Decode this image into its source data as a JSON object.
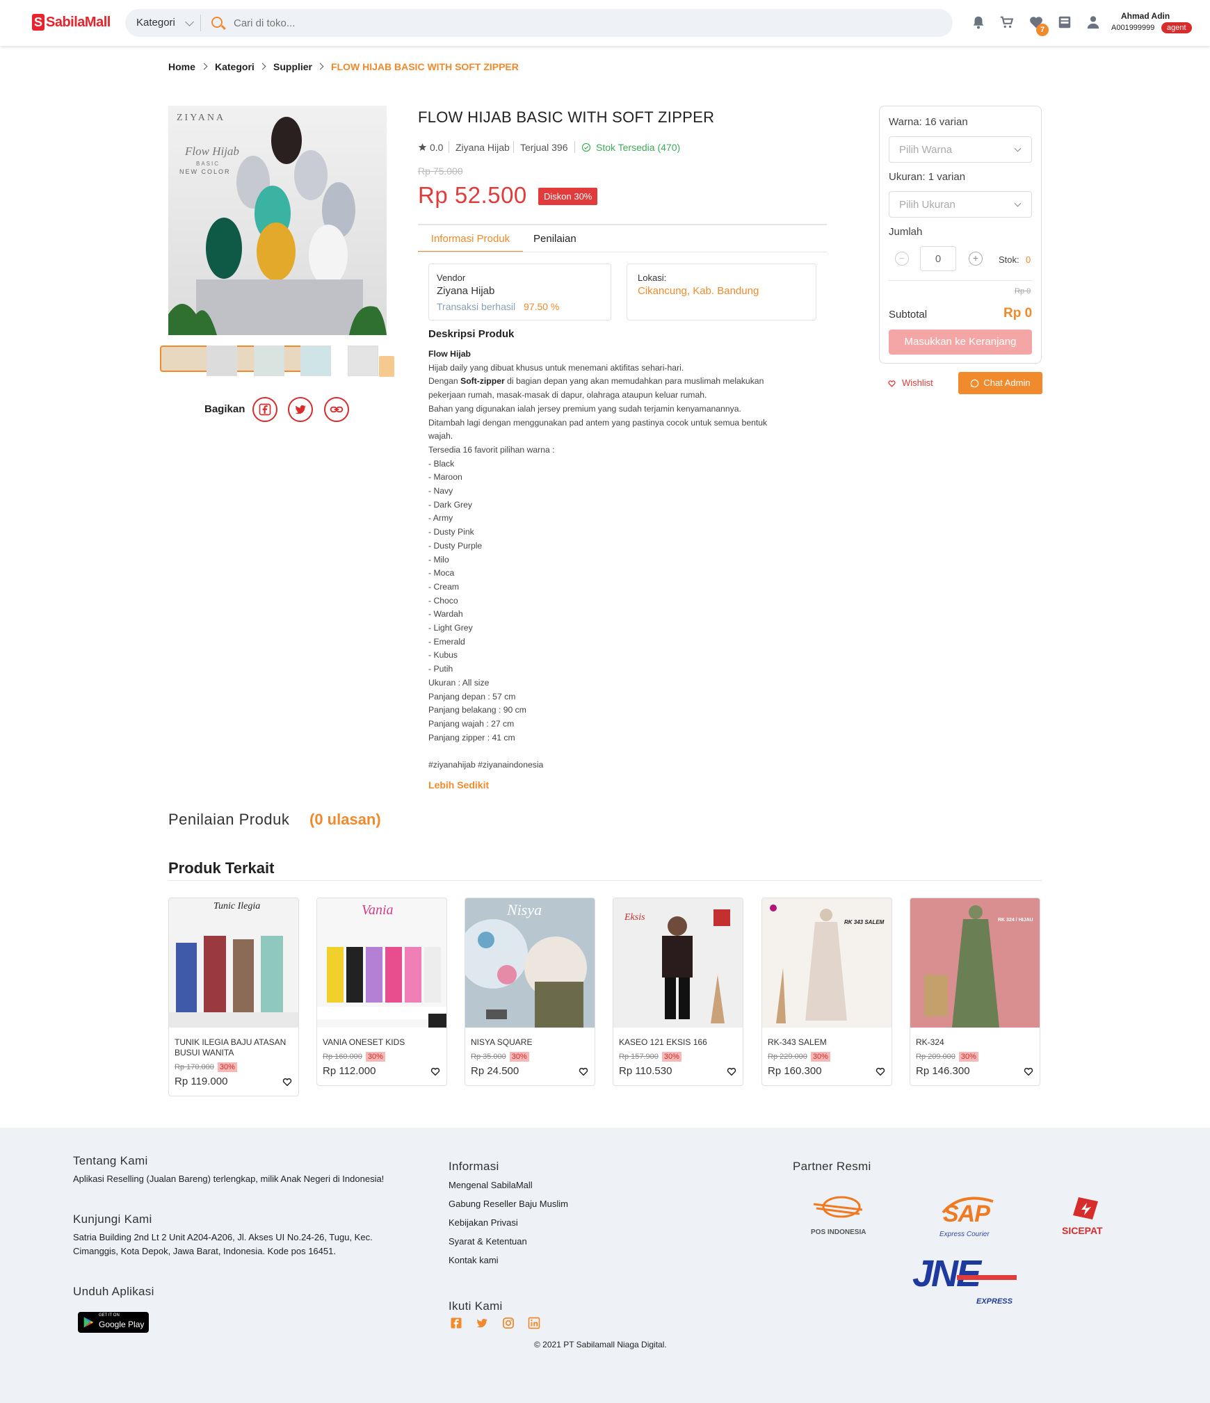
{
  "header": {
    "logo_mark": "S",
    "logo_text": "SabilaMall",
    "category_label": "Kategori",
    "search_placeholder": "Cari di toko...",
    "wishlist_badge": "7",
    "user_name": "Ahmad Adin",
    "user_id": "A001999999",
    "user_role": "agent",
    "icons": [
      "bell-icon",
      "cart-icon",
      "heart-icon",
      "inbox-icon",
      "user-icon"
    ]
  },
  "breadcrumb": [
    "Home",
    "Kategori",
    "Supplier",
    "FLOW HIJAB BASIC WITH SOFT ZIPPER"
  ],
  "gallery": {
    "brand_text": "ZIYANA",
    "script_text": "Flow Hijab",
    "sub_text": "BASIC",
    "sub_text2": "NEW COLOR",
    "share_label": "Bagikan",
    "share_icons": [
      "facebook-icon",
      "twitter-icon",
      "link-icon"
    ]
  },
  "product": {
    "title": "FLOW HIJAB BASIC WITH SOFT ZIPPER",
    "rating": "0.0",
    "seller": "Ziyana Hijab",
    "sold": "Terjual 396",
    "stock": "Stok Tersedia (470)",
    "old_price": "Rp 75.000",
    "price": "Rp 52.500",
    "discount": "Diskon 30%",
    "tabs": [
      "Informasi Produk",
      "Penilaian"
    ],
    "vendor_label": "Vendor",
    "vendor_name": "Ziyana Hijab",
    "transaksi_label": "Transaksi berhasil",
    "transaksi_value": "97.50 %",
    "lokasi_label": "Lokasi:",
    "lokasi_value": "Cikancung, Kab. Bandung",
    "desc_heading": "Deskripsi Produk",
    "desc_title": "Flow Hijab",
    "desc_line1": "Hijab daily yang dibuat khusus untuk menemani aktifitas sehari-hari.",
    "desc_line2_pre": "Dengan ",
    "desc_line2_bold": "Soft-zipper",
    "desc_line2_post": " di bagian depan yang akan memudahkan para muslimah melakukan\npekerjaan rumah, masak-masak di dapur, olahraga ataupun keluar rumah.",
    "desc_rest": "Bahan yang digunakan ialah jersey premium yang sudah terjamin kenyamanannya.\nDitambah lagi dengan menggunakan pad antem yang pastinya cocok untuk semua bentuk\nwajah.\nTersedia 16 favorit pilihan warna :\n- Black\n- Maroon\n- Navy\n- Dark Grey\n- Army\n- Dusty Pink\n- Dusty Purple\n- Milo\n- Moca\n- Cream\n- Choco\n- Wardah\n- Light Grey\n- Emerald\n- Kubus\n- Putih\nUkuran : All size\nPanjang depan : 57 cm\nPanjang belakang : 90 cm\nPanjang wajah : 27 cm\nPanjang zipper : 41 cm\n\n#ziyanahijab #ziyanaindonesia",
    "less_link": "Lebih Sedikit"
  },
  "purchase": {
    "warna_label": "Warna: 16 varian",
    "warna_placeholder": "Pilih Warna",
    "ukuran_label": "Ukuran: 1 varian",
    "ukuran_placeholder": "Pilih Ukuran",
    "jumlah_label": "Jumlah",
    "qty_minus": "−",
    "qty_value": "0",
    "qty_plus": "+",
    "stok_label": "Stok:",
    "stok_value": "0",
    "small_price": "Rp 0",
    "subtotal_label": "Subtotal",
    "subtotal_value": "Rp 0",
    "add_to_cart": "Masukkan ke Keranjang",
    "wishlist": "Wishlist",
    "chat_admin": "Chat Admin"
  },
  "ratings": {
    "heading": "Penilaian Produk",
    "count": "(0 ulasan)"
  },
  "related": {
    "heading": "Produk Terkait",
    "items": [
      {
        "name": "TUNIK ILEGIA BAJU ATASAN BUSUI WANITA",
        "old_price": "Rp 170.000",
        "pct": "30%",
        "price": "Rp 119.000",
        "color": "#9a3a3f",
        "img_title": "Tunic Ilegia"
      },
      {
        "name": "VANIA ONESET KIDS",
        "old_price": "Rp 160.000",
        "pct": "30%",
        "price": "Rp 112.000",
        "color": "#e45a9a",
        "img_title": "Vania"
      },
      {
        "name": "NISYA SQUARE",
        "old_price": "Rp 35.000",
        "pct": "30%",
        "price": "Rp 24.500",
        "color": "#8ab3c8",
        "img_title": "Nisya"
      },
      {
        "name": "KASEO 121 EKSIS 166",
        "old_price": "Rp 157.900",
        "pct": "30%",
        "price": "Rp 110.530",
        "color": "#3a2a2a",
        "img_title": "Eksis"
      },
      {
        "name": "RK-343 SALEM",
        "old_price": "Rp 229.000",
        "pct": "30%",
        "price": "Rp 160.300",
        "color": "#e2d6cc",
        "img_title": "RK 343 SALEM"
      },
      {
        "name": "RK-324",
        "old_price": "Rp 209.000",
        "pct": "30%",
        "price": "Rp 146.300",
        "color": "#6b7f55",
        "img_title": "RK 324 / HIJAU"
      }
    ]
  },
  "footer": {
    "about_h": "Tentang Kami",
    "about_t": "Aplikasi Reselling (Jualan Bareng) terlengkap, milik Anak Negeri di Indonesia!",
    "visit_h": "Kunjungi Kami",
    "visit_t": "Satria Building 2nd Lt 2 Unit A204-A206, Jl. Akses UI No.24-26, Tugu, Kec.\nCimanggis, Kota Depok, Jawa Barat, Indonesia. Kode pos 16451.",
    "download_h": "Unduh Aplikasi",
    "gplay_small": "GET IT ON",
    "gplay": "Google Play",
    "info_h": "Informasi",
    "info_links": [
      "Mengenal SabilaMall",
      "Gabung Reseller Baju Muslim",
      "Kebijakan Privasi",
      "Syarat & Ketentuan",
      "Kontak kami"
    ],
    "follow_h": "Ikuti Kami",
    "social_icons": [
      "facebook-icon",
      "twitter-icon",
      "instagram-icon",
      "linkedin-icon"
    ],
    "copyright": "© 2021 PT Sabilamall Niaga Digital.",
    "partner_h": "Partner Resmi",
    "partners": [
      "POS INDONESIA",
      "SAP",
      "Express Courier",
      "SICEPAT",
      "JNE",
      "EXPRESS"
    ]
  },
  "colors": {
    "brand_red": "#e8232c",
    "accent_orange": "#f08a2c",
    "price_red": "#e23b3b",
    "stock_green": "#3cab5a"
  }
}
